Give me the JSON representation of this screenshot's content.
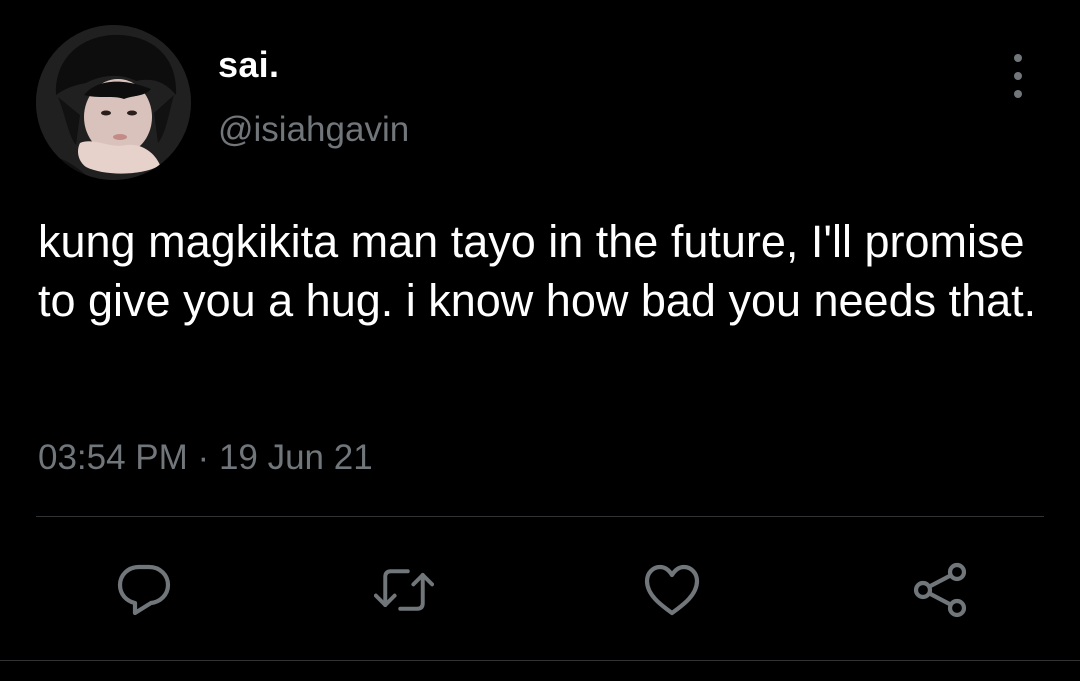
{
  "tweet": {
    "author": {
      "display_name": "sai.",
      "handle": "@isiahgavin",
      "avatar": "avatar-photo"
    },
    "more_icon": "more-vertical-icon",
    "text": "kung magkikita man tayo in the future, I'll promise to give you a hug. i know how bad you needs that.",
    "time": "03:54 PM",
    "separator": "·",
    "date": "19 Jun 21"
  },
  "actions": [
    {
      "name": "reply",
      "icon": "reply-icon"
    },
    {
      "name": "retweet",
      "icon": "retweet-icon"
    },
    {
      "name": "like",
      "icon": "heart-icon"
    },
    {
      "name": "share",
      "icon": "share-icon"
    }
  ],
  "colors": {
    "background": "#000000",
    "primary_text": "#ffffff",
    "secondary_text": "#71767b",
    "divider": "#2f3336"
  }
}
